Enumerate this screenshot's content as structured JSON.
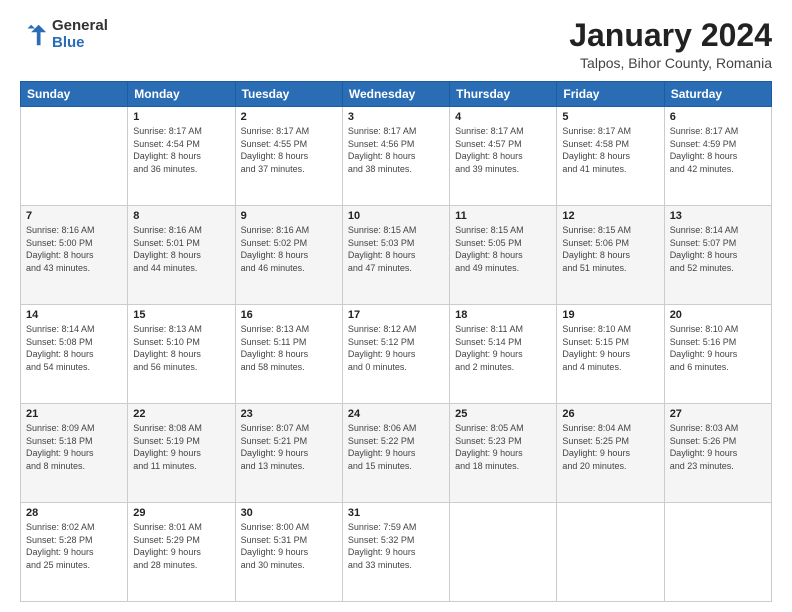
{
  "logo": {
    "general": "General",
    "blue": "Blue"
  },
  "title": "January 2024",
  "subtitle": "Talpos, Bihor County, Romania",
  "days_of_week": [
    "Sunday",
    "Monday",
    "Tuesday",
    "Wednesday",
    "Thursday",
    "Friday",
    "Saturday"
  ],
  "weeks": [
    [
      {
        "day": "",
        "info": ""
      },
      {
        "day": "1",
        "info": "Sunrise: 8:17 AM\nSunset: 4:54 PM\nDaylight: 8 hours\nand 36 minutes."
      },
      {
        "day": "2",
        "info": "Sunrise: 8:17 AM\nSunset: 4:55 PM\nDaylight: 8 hours\nand 37 minutes."
      },
      {
        "day": "3",
        "info": "Sunrise: 8:17 AM\nSunset: 4:56 PM\nDaylight: 8 hours\nand 38 minutes."
      },
      {
        "day": "4",
        "info": "Sunrise: 8:17 AM\nSunset: 4:57 PM\nDaylight: 8 hours\nand 39 minutes."
      },
      {
        "day": "5",
        "info": "Sunrise: 8:17 AM\nSunset: 4:58 PM\nDaylight: 8 hours\nand 41 minutes."
      },
      {
        "day": "6",
        "info": "Sunrise: 8:17 AM\nSunset: 4:59 PM\nDaylight: 8 hours\nand 42 minutes."
      }
    ],
    [
      {
        "day": "7",
        "info": "Sunrise: 8:16 AM\nSunset: 5:00 PM\nDaylight: 8 hours\nand 43 minutes."
      },
      {
        "day": "8",
        "info": "Sunrise: 8:16 AM\nSunset: 5:01 PM\nDaylight: 8 hours\nand 44 minutes."
      },
      {
        "day": "9",
        "info": "Sunrise: 8:16 AM\nSunset: 5:02 PM\nDaylight: 8 hours\nand 46 minutes."
      },
      {
        "day": "10",
        "info": "Sunrise: 8:15 AM\nSunset: 5:03 PM\nDaylight: 8 hours\nand 47 minutes."
      },
      {
        "day": "11",
        "info": "Sunrise: 8:15 AM\nSunset: 5:05 PM\nDaylight: 8 hours\nand 49 minutes."
      },
      {
        "day": "12",
        "info": "Sunrise: 8:15 AM\nSunset: 5:06 PM\nDaylight: 8 hours\nand 51 minutes."
      },
      {
        "day": "13",
        "info": "Sunrise: 8:14 AM\nSunset: 5:07 PM\nDaylight: 8 hours\nand 52 minutes."
      }
    ],
    [
      {
        "day": "14",
        "info": "Sunrise: 8:14 AM\nSunset: 5:08 PM\nDaylight: 8 hours\nand 54 minutes."
      },
      {
        "day": "15",
        "info": "Sunrise: 8:13 AM\nSunset: 5:10 PM\nDaylight: 8 hours\nand 56 minutes."
      },
      {
        "day": "16",
        "info": "Sunrise: 8:13 AM\nSunset: 5:11 PM\nDaylight: 8 hours\nand 58 minutes."
      },
      {
        "day": "17",
        "info": "Sunrise: 8:12 AM\nSunset: 5:12 PM\nDaylight: 9 hours\nand 0 minutes."
      },
      {
        "day": "18",
        "info": "Sunrise: 8:11 AM\nSunset: 5:14 PM\nDaylight: 9 hours\nand 2 minutes."
      },
      {
        "day": "19",
        "info": "Sunrise: 8:10 AM\nSunset: 5:15 PM\nDaylight: 9 hours\nand 4 minutes."
      },
      {
        "day": "20",
        "info": "Sunrise: 8:10 AM\nSunset: 5:16 PM\nDaylight: 9 hours\nand 6 minutes."
      }
    ],
    [
      {
        "day": "21",
        "info": "Sunrise: 8:09 AM\nSunset: 5:18 PM\nDaylight: 9 hours\nand 8 minutes."
      },
      {
        "day": "22",
        "info": "Sunrise: 8:08 AM\nSunset: 5:19 PM\nDaylight: 9 hours\nand 11 minutes."
      },
      {
        "day": "23",
        "info": "Sunrise: 8:07 AM\nSunset: 5:21 PM\nDaylight: 9 hours\nand 13 minutes."
      },
      {
        "day": "24",
        "info": "Sunrise: 8:06 AM\nSunset: 5:22 PM\nDaylight: 9 hours\nand 15 minutes."
      },
      {
        "day": "25",
        "info": "Sunrise: 8:05 AM\nSunset: 5:23 PM\nDaylight: 9 hours\nand 18 minutes."
      },
      {
        "day": "26",
        "info": "Sunrise: 8:04 AM\nSunset: 5:25 PM\nDaylight: 9 hours\nand 20 minutes."
      },
      {
        "day": "27",
        "info": "Sunrise: 8:03 AM\nSunset: 5:26 PM\nDaylight: 9 hours\nand 23 minutes."
      }
    ],
    [
      {
        "day": "28",
        "info": "Sunrise: 8:02 AM\nSunset: 5:28 PM\nDaylight: 9 hours\nand 25 minutes."
      },
      {
        "day": "29",
        "info": "Sunrise: 8:01 AM\nSunset: 5:29 PM\nDaylight: 9 hours\nand 28 minutes."
      },
      {
        "day": "30",
        "info": "Sunrise: 8:00 AM\nSunset: 5:31 PM\nDaylight: 9 hours\nand 30 minutes."
      },
      {
        "day": "31",
        "info": "Sunrise: 7:59 AM\nSunset: 5:32 PM\nDaylight: 9 hours\nand 33 minutes."
      },
      {
        "day": "",
        "info": ""
      },
      {
        "day": "",
        "info": ""
      },
      {
        "day": "",
        "info": ""
      }
    ]
  ]
}
